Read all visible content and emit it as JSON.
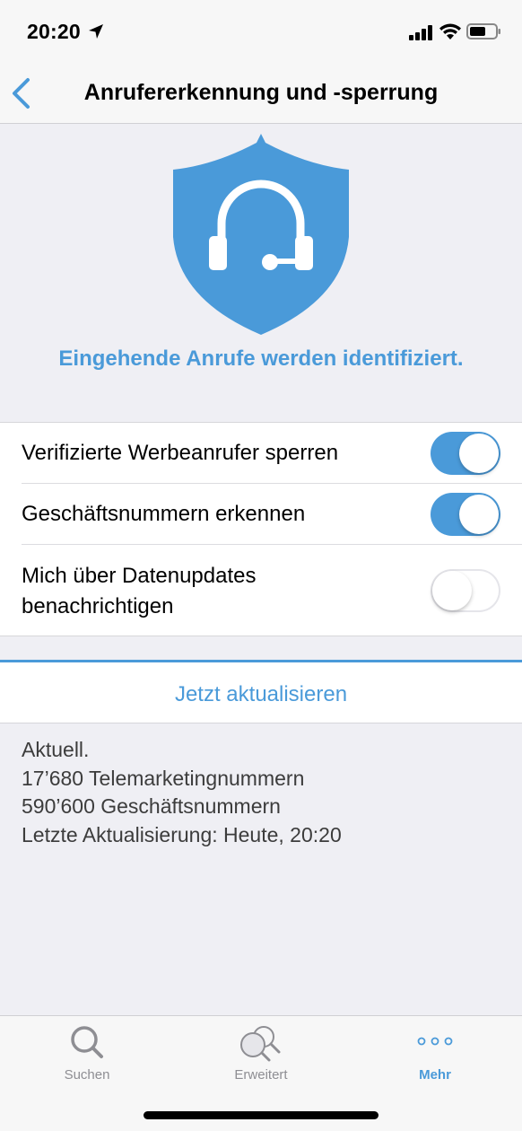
{
  "status_bar": {
    "time": "20:20",
    "icons": [
      "location-arrow-icon",
      "signal-icon",
      "wifi-icon",
      "battery-icon"
    ]
  },
  "nav": {
    "title": "Anrufererkennung und -sperrung",
    "back_icon": "chevron-left-icon"
  },
  "hero": {
    "icon": "shield-headset-icon",
    "status_message": "Eingehende Anrufe werden identifiziert."
  },
  "settings": [
    {
      "label": "Verifizierte Werbeanrufer sperren",
      "enabled": true
    },
    {
      "label": "Geschäftsnummern erkennen",
      "enabled": true
    },
    {
      "label_line1": "Mich über Datenupdates",
      "label_line2": "benachrichtigen",
      "enabled": false
    }
  ],
  "update": {
    "button_label": "Jetzt aktualisieren"
  },
  "info": {
    "status": "Aktuell.",
    "telemarketing": "17’680 Telemarketingnummern",
    "business": "590’600 Geschäftsnummern",
    "last_update": "Letzte Aktualisierung: Heute, 20:20"
  },
  "tab_bar": {
    "tabs": [
      {
        "label": "Suchen",
        "icon": "search-icon",
        "active": false
      },
      {
        "label": "Erweitert",
        "icon": "advanced-search-icon",
        "active": false
      },
      {
        "label": "Mehr",
        "icon": "more-dots-icon",
        "active": true
      }
    ]
  },
  "colors": {
    "accent": "#4a9ad9",
    "background": "#efeff4",
    "inactive_tab": "#8e8e93"
  }
}
